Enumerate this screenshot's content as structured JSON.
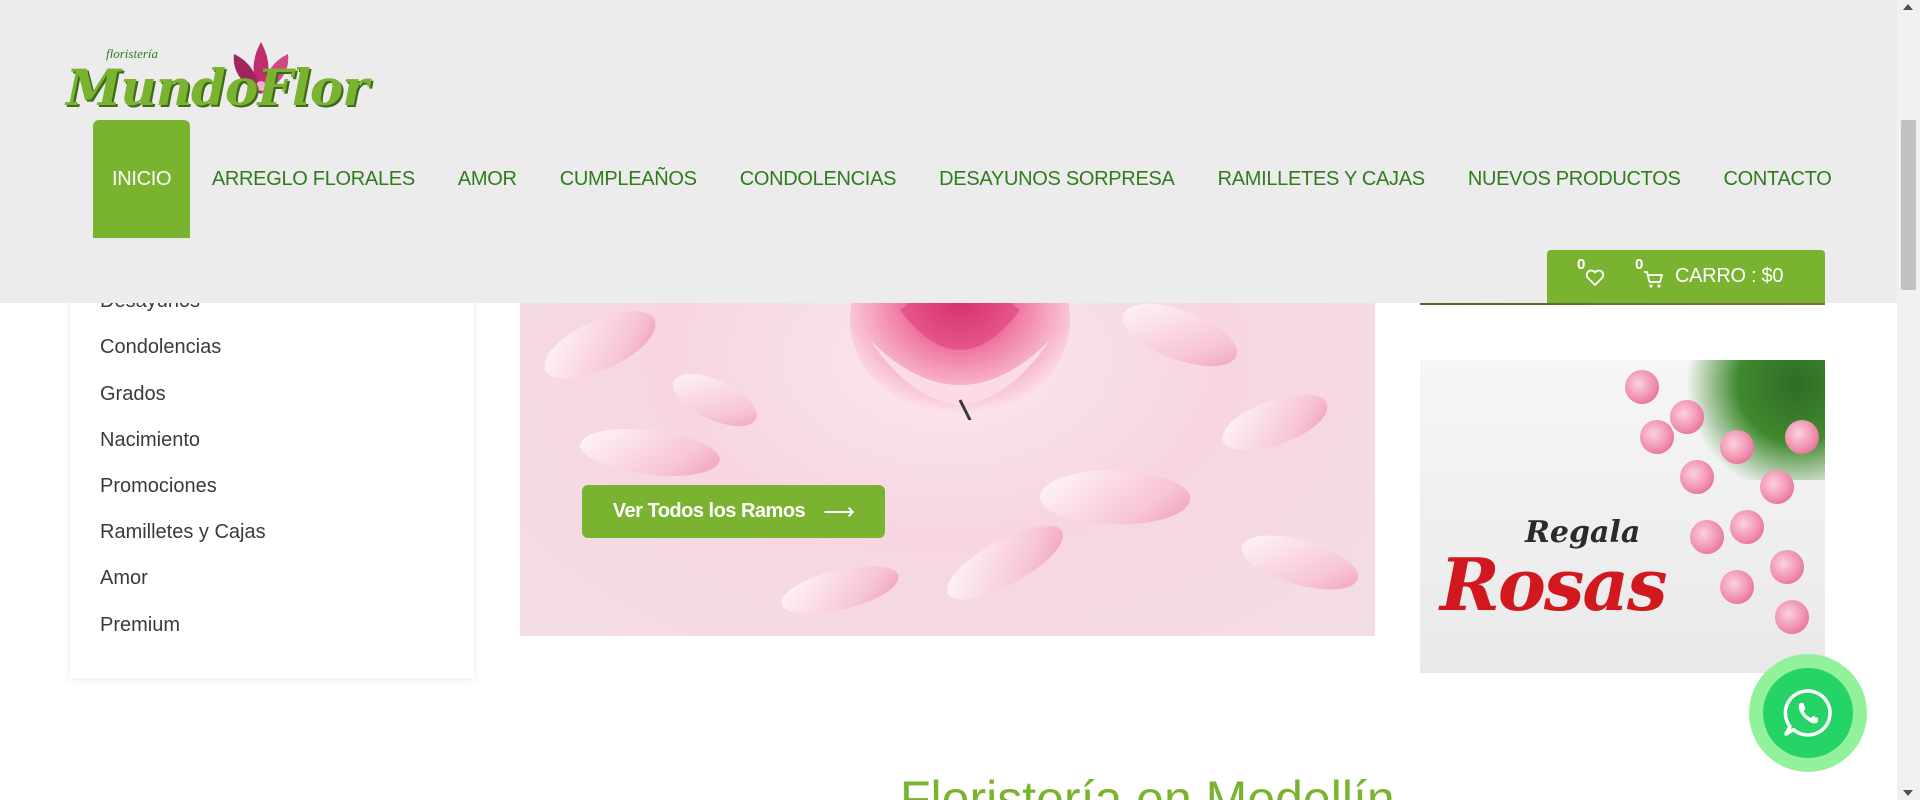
{
  "logo": {
    "small_text": "floristería",
    "main_text": "MundoFlor"
  },
  "nav": {
    "items": [
      {
        "label": "INICIO",
        "active": true
      },
      {
        "label": "ARREGLO FLORALES"
      },
      {
        "label": "AMOR"
      },
      {
        "label": "CUMPLEAÑOS"
      },
      {
        "label": "CONDOLENCIAS"
      },
      {
        "label": "DESAYUNOS SORPRESA"
      },
      {
        "label": "RAMILLETES Y CAJAS"
      },
      {
        "label": "NUEVOS PRODUCTOS"
      },
      {
        "label": "CONTACTO"
      }
    ]
  },
  "cart": {
    "wishlist_count": "0",
    "cart_count": "0",
    "label": "CARRO : $0"
  },
  "sidebar": {
    "categories": [
      "Desayunos",
      "Condolencias",
      "Grados",
      "Nacimiento",
      "Promociones",
      "Ramilletes y Cajas",
      "Amor",
      "Premium"
    ]
  },
  "banner": {
    "button_label": "Ver Todos los Ramos",
    "button_arrow": "⟶"
  },
  "promo": {
    "line1": "Regala",
    "line2": "Rosas"
  },
  "main": {
    "heading": "Floristería en Medellín"
  },
  "colors": {
    "brand_green": "#7ab32f",
    "nav_text": "#2f7b1e",
    "header_bg": "#ececec",
    "whatsapp": "#25d366"
  },
  "icons": [
    "heart-icon",
    "cart-icon",
    "whatsapp-icon",
    "arrow-right-icon"
  ]
}
